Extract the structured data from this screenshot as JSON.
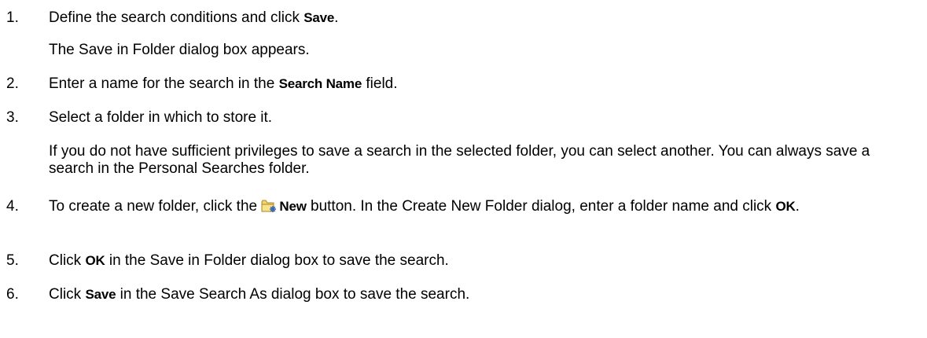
{
  "steps": [
    {
      "num": "1.",
      "pre": "Define the search conditions and click ",
      "ui": "Save",
      "post": ".",
      "note": "The Save in Folder dialog box appears."
    },
    {
      "num": "2.",
      "pre": "Enter a name for the search in the ",
      "ui": "Search Name",
      "post": " field."
    },
    {
      "num": "3.",
      "text": "Select a folder in which to store it.",
      "note": "If you do not have sufficient privileges to save a search in the selected folder, you can select another. You can always save a search in the Personal Searches folder."
    },
    {
      "num": "4.",
      "pre": "To create a new folder, click the ",
      "icon": "new-folder-icon",
      "ui": "New",
      "mid": " button. In the Create New Folder dialog, enter a folder name and click ",
      "ui2": "OK",
      "post": "."
    },
    {
      "num": "5.",
      "pre": "Click ",
      "ui": "OK",
      "post": " in the Save in Folder dialog box to save the search."
    },
    {
      "num": "6.",
      "pre": "Click ",
      "ui": "Save",
      "post": " in the Save Search As dialog box to save the search."
    }
  ]
}
